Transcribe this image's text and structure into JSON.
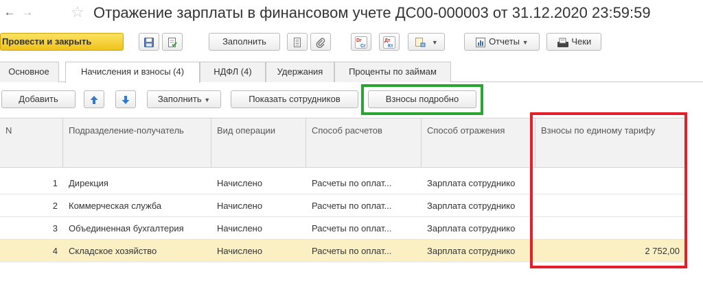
{
  "window": {
    "title": "Отражение зарплаты в финансовом учете ДС00-000003 от 31.12.2020 23:59:59"
  },
  "toolbar": {
    "post_close_label": "Провести и закрыть",
    "fill_label": "Заполнить",
    "dr_label": "Dr",
    "cr_label": "Cr",
    "dt_label": "Дт",
    "kt_label": "Кт",
    "reports_label": "Отчеты",
    "checks_label": "Чеки"
  },
  "tabs": [
    {
      "label": "Основное"
    },
    {
      "label": "Начисления и взносы (4)"
    },
    {
      "label": "НДФЛ (4)"
    },
    {
      "label": "Удержания"
    },
    {
      "label": "Проценты по займам"
    }
  ],
  "table_toolbar": {
    "add_label": "Добавить",
    "fill_label": "Заполнить",
    "show_employees_label": "Показать сотрудников",
    "contributions_detail_label": "Взносы подробно"
  },
  "table": {
    "columns": [
      "N",
      "Подразделение-получатель",
      "Вид операции",
      "Способ расчетов",
      "Способ отражения",
      "Взносы по единому тарифу"
    ],
    "rows": [
      {
        "n": "1",
        "dept": "Дирекция",
        "op": "Начислено",
        "calc": "Расчеты по оплат...",
        "reflect": "Зарплата сотруднико",
        "contrib": ""
      },
      {
        "n": "2",
        "dept": "Коммерческая служба",
        "op": "Начислено",
        "calc": "Расчеты по оплат...",
        "reflect": "Зарплата сотруднико",
        "contrib": ""
      },
      {
        "n": "3",
        "dept": "Объединенная бухгалтерия",
        "op": "Начислено",
        "calc": "Расчеты по оплат...",
        "reflect": "Зарплата сотруднико",
        "contrib": ""
      },
      {
        "n": "4",
        "dept": "Складское хозяйство",
        "op": "Начислено",
        "calc": "Расчеты по оплат...",
        "reflect": "Зарплата сотруднико",
        "contrib": "2 752,00"
      }
    ]
  },
  "colors": {
    "primary_button": "#f0c21a",
    "selected_row": "#fbf0c4",
    "highlight_green": "#2aa532",
    "highlight_red": "#e3202a"
  },
  "icons": [
    "back-arrow-icon",
    "forward-arrow-icon",
    "favorite-star-icon",
    "save-icon",
    "post-doc-icon",
    "document-icon",
    "paperclip-icon",
    "dr-cr-icon",
    "dt-kt-icon",
    "create-based-icon",
    "report-icon",
    "check-icon",
    "arrow-up-icon",
    "arrow-down-icon"
  ]
}
